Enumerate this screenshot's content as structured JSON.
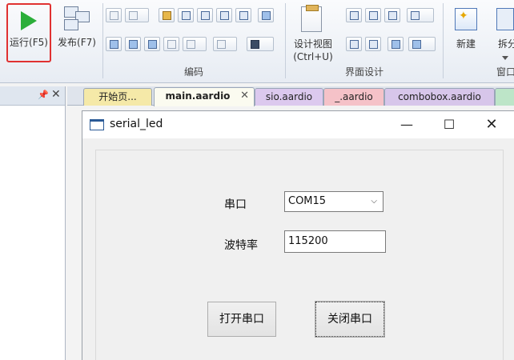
{
  "ribbon": {
    "run_label": "运行(F5)",
    "publish_label": "发布(F7)",
    "edit_group_label": "编码",
    "design_view_label_1": "设计视图",
    "design_view_label_2": "(Ctrl+U)",
    "ui_design_group_label": "界面设计",
    "new_label": "新建",
    "split_label": "拆分",
    "window_group_label": "窗口",
    "accent_run": "#2bae3a",
    "highlight_border": "#e03131"
  },
  "left_pane": {
    "pin_icon": "pin-icon",
    "close_glyph": "✕"
  },
  "tabs": [
    {
      "label": "开始页...",
      "color": "#f5e9a8"
    },
    {
      "label": "main.aardio",
      "color": "#fbfbf0",
      "active": true,
      "close": "✕"
    },
    {
      "label": "sio.aardio",
      "color": "#dcc9ee"
    },
    {
      "label": "_.aardio",
      "color": "#f5c2c8"
    },
    {
      "label": "combobox.aardio",
      "color": "#d7c6ea"
    },
    {
      "label": "",
      "color": "#bde5c8"
    }
  ],
  "designer": {
    "window_title": "serial_led",
    "minimize_glyph": "—",
    "maximize_glyph": "☐",
    "close_glyph": "✕",
    "port_label": "串口",
    "port_value": "COM15",
    "baud_label": "波特率",
    "baud_value": "115200",
    "open_port_label": "打开串口",
    "close_port_label": "关闭串口"
  }
}
